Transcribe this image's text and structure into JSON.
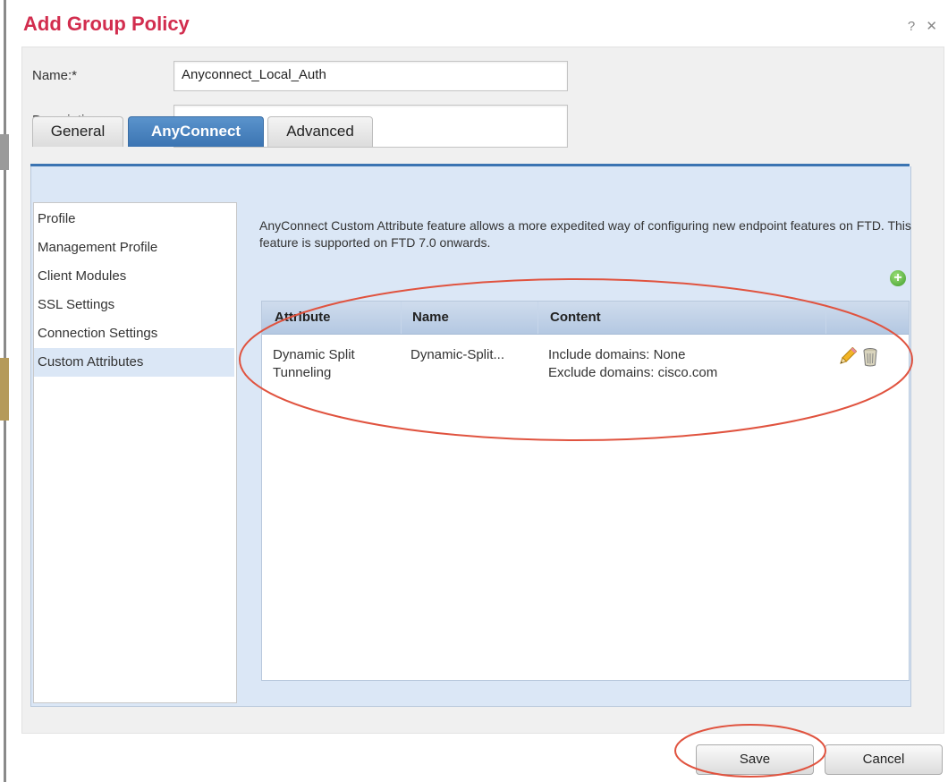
{
  "dialog": {
    "title": "Add Group Policy",
    "window_controls": "? ✕"
  },
  "form": {
    "name_label": "Name:*",
    "name_value": "Anyconnect_Local_Auth",
    "description_label": "Description:",
    "description_value": ""
  },
  "tabs": [
    {
      "label": "General",
      "active": false
    },
    {
      "label": "AnyConnect",
      "active": true
    },
    {
      "label": "Advanced",
      "active": false
    }
  ],
  "sidebar": {
    "items": [
      {
        "label": "Profile"
      },
      {
        "label": "Management Profile"
      },
      {
        "label": "Client Modules"
      },
      {
        "label": "SSL Settings"
      },
      {
        "label": "Connection Settings"
      },
      {
        "label": "Custom Attributes",
        "selected": true
      }
    ]
  },
  "main": {
    "description": "AnyConnect Custom Attribute feature allows a more expedited way of configuring new endpoint features on FTD. This feature is supported on FTD 7.0 onwards.",
    "add_icon": "+"
  },
  "table": {
    "headers": [
      "Attribute",
      "Name",
      "Content"
    ],
    "rows": [
      {
        "attribute_line1": "Dynamic Split",
        "attribute_line2": "Tunneling",
        "name": "Dynamic-Split...",
        "content_line1": "Include domains: None",
        "content_line2": "Exclude domains: cisco.com",
        "actions": [
          "pencil-icon",
          "trash-icon"
        ]
      }
    ]
  },
  "buttons": {
    "save": "Save",
    "cancel": "Cancel"
  },
  "colors": {
    "title": "#d22d4e",
    "tab_active": "#3b74b2",
    "content_bg": "#dbe7f6",
    "annotation": "#e0533f",
    "add_icon": "#3f9c2a"
  }
}
